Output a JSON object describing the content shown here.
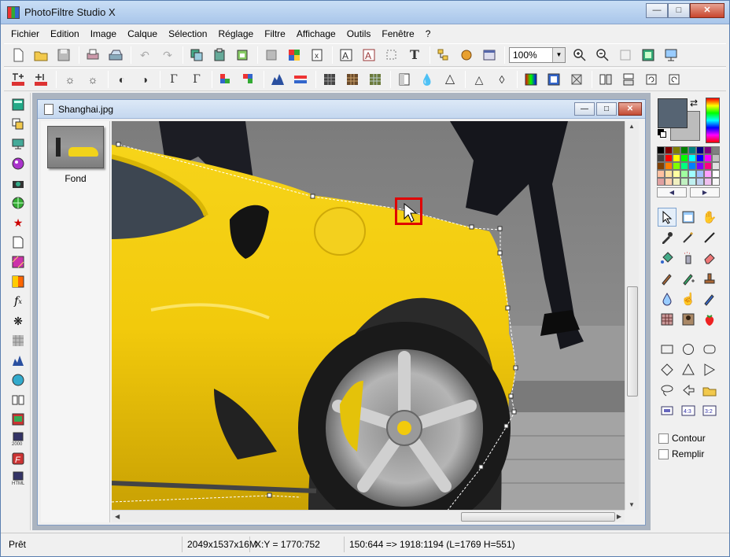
{
  "window": {
    "title": "PhotoFiltre Studio X"
  },
  "menu": [
    "Fichier",
    "Edition",
    "Image",
    "Calque",
    "Sélection",
    "Réglage",
    "Filtre",
    "Affichage",
    "Outils",
    "Fenêtre",
    "?"
  ],
  "toolbar": {
    "zoom_value": "100%",
    "text_tool_glyph": "T"
  },
  "document": {
    "title": "Shanghai.jpg",
    "layer_name": "Fond"
  },
  "options": {
    "contour_label": "Contour",
    "remplir_label": "Remplir"
  },
  "status": {
    "state": "Prêt",
    "image_size": "2049x1537x16M",
    "cursor": "X:Y = 1770:752",
    "selection": "150:644 => 1918:1194 (L=1769  H=551)"
  },
  "colors": {
    "foreground": "#566473",
    "background": "#bcbcbc",
    "accent": "#e00000"
  },
  "icons": {
    "toolbar1": [
      "new-file-icon",
      "open-folder-icon",
      "save-icon",
      "print-icon",
      "scan-icon",
      "undo-icon",
      "redo-icon",
      "copy-icon",
      "paste-icon",
      "paste-new-icon",
      "stamp-icon",
      "palette-icon",
      "filter-repeat-icon",
      "text-mask-icon",
      "text-tool-icon",
      "select-icon",
      "text-icon",
      "folder-tree-icon",
      "plugin-icon",
      "fullscreen-icon",
      "zoom-in-icon",
      "zoom-out-icon",
      "fit-icon",
      "zoom-fit-icon",
      "slideshow-icon"
    ],
    "right_tools": [
      "pointer-icon",
      "magic-layer-icon",
      "hand-icon",
      "eyedropper-icon",
      "magic-wand-icon",
      "line-icon",
      "fill-bucket-icon",
      "spray-icon",
      "eraser-icon",
      "brush-icon",
      "advanced-brush-icon",
      "stamp-tool-icon",
      "blur-drop-icon",
      "finger-icon",
      "smudge-icon",
      "pattern-icon",
      "portrait-icon",
      "strawberry-icon",
      "rectangle-icon",
      "ellipse-icon",
      "rounded-rect-icon",
      "diamond-icon",
      "triangle-icon",
      "arrow-right-icon",
      "lasso-icon",
      "polygon-icon",
      "open-shape-icon",
      "ratio-1-icon",
      "ratio-4-3-icon",
      "ratio-3-2-icon"
    ]
  }
}
